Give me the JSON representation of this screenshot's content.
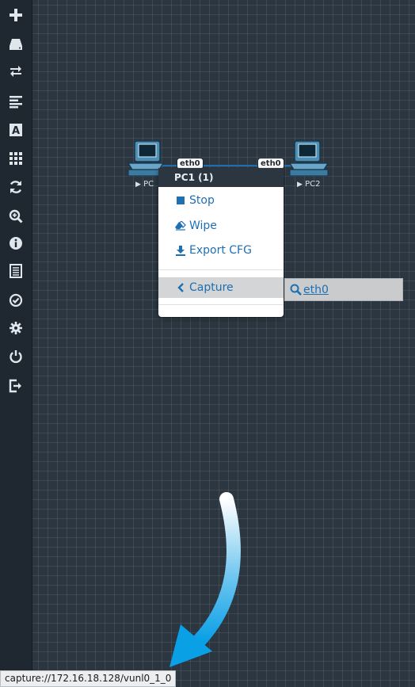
{
  "sidebar": {
    "items": [
      {
        "icon": "plus-icon"
      },
      {
        "icon": "drive-icon"
      },
      {
        "icon": "exchange-icon"
      },
      {
        "icon": "align-left-icon"
      },
      {
        "icon": "text-font-icon"
      },
      {
        "icon": "grid-icon"
      },
      {
        "icon": "refresh-icon"
      },
      {
        "icon": "zoom-in-icon"
      },
      {
        "icon": "info-icon"
      },
      {
        "icon": "list-icon"
      },
      {
        "icon": "check-circle-icon"
      },
      {
        "icon": "settings-icon"
      },
      {
        "icon": "power-icon"
      },
      {
        "icon": "logout-icon"
      }
    ]
  },
  "topology": {
    "nodes": [
      {
        "label": "PC1",
        "visible_label": "PC"
      },
      {
        "label": "PC2",
        "visible_label": "PC2"
      }
    ],
    "link": {
      "left_interface": "eth0",
      "right_interface": "eth0"
    }
  },
  "context_menu": {
    "title": "PC1 (1)",
    "items": [
      {
        "label": "Stop",
        "icon": "stop-icon"
      },
      {
        "label": "Wipe",
        "icon": "eraser-icon"
      },
      {
        "label": "Export CFG",
        "icon": "download-icon"
      },
      {
        "label": "Capture",
        "icon": "chevron-left-icon"
      }
    ]
  },
  "capture_submenu": {
    "label": "eth0",
    "icon": "search-icon"
  },
  "status_bar": {
    "url": "capture://172.16.18.128/vunl0_1_0"
  },
  "colors": {
    "canvas": "#2b3640",
    "sidebar": "#1f2830",
    "link_blue": "#1f6fb3",
    "arrow": "#0aa0e6"
  }
}
